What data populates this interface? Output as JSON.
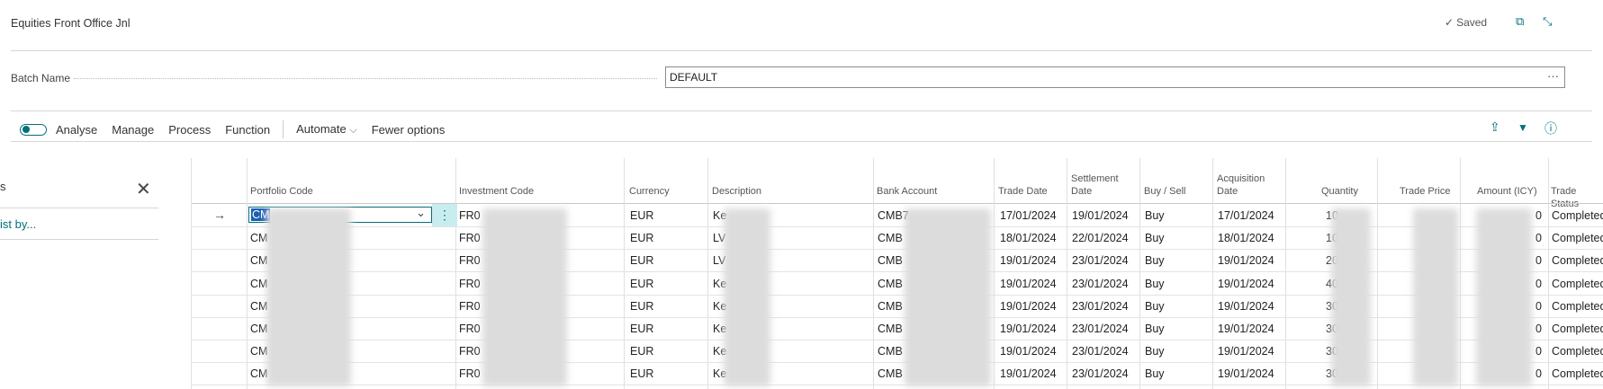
{
  "header": {
    "title": "Equities Front Office Jnl",
    "saved_label": "Saved",
    "saved_check": "✓",
    "open_new_window_icon": "⧉",
    "collapse_icon": "⤡"
  },
  "batch": {
    "label": "Batch Name",
    "value": "DEFAULT",
    "lookup_glyph": "···"
  },
  "toolbar": {
    "items": [
      "Analyse",
      "Manage",
      "Process",
      "Function"
    ],
    "automate": "Automate",
    "automate_chevron": "⌵",
    "fewer_options": "Fewer options",
    "share_icon": "⇪",
    "filter_icon": "▼",
    "info_icon": "ⓘ"
  },
  "factbox": {
    "fragment_top": "s",
    "close_icon": "✕",
    "link": "ist by..."
  },
  "columns": {
    "portfolio_code": "Portfolio Code",
    "investment_code": "Investment Code",
    "currency": "Currency",
    "description": "Description",
    "bank_account": "Bank Account",
    "trade_date": "Trade Date",
    "settlement_date_l1": "Settlement",
    "settlement_date_l2": "Date",
    "buy_sell": "Buy / Sell",
    "acquisition_date_l1": "Acquisition",
    "acquisition_date_l2": "Date",
    "quantity": "Quantity",
    "trade_price": "Trade Price",
    "amount_icy": "Amount (ICY)",
    "trade_status": "Trade Status"
  },
  "rows": [
    {
      "portfolio": "CM",
      "investment": "FR0",
      "currency": "EUR",
      "description": "Ke",
      "bank": "CMB7",
      "trade_date": "17/01/2024",
      "settlement": "19/01/2024",
      "buy_sell": "Buy",
      "acquisition": "17/01/2024",
      "quantity": "10",
      "amount_tail": "0",
      "status": "Completed"
    },
    {
      "portfolio": "CM",
      "investment": "FR0",
      "currency": "EUR",
      "description": "LV",
      "bank": "CMB",
      "trade_date": "18/01/2024",
      "settlement": "22/01/2024",
      "buy_sell": "Buy",
      "acquisition": "18/01/2024",
      "quantity": "10",
      "amount_tail": "0",
      "status": "Completed"
    },
    {
      "portfolio": "CM",
      "investment": "FR0",
      "currency": "EUR",
      "description": "LV",
      "bank": "CMB",
      "trade_date": "19/01/2024",
      "settlement": "23/01/2024",
      "buy_sell": "Buy",
      "acquisition": "19/01/2024",
      "quantity": "20",
      "amount_tail": "0",
      "status": "Completed"
    },
    {
      "portfolio": "CM",
      "investment": "FR0",
      "currency": "EUR",
      "description": "Ke",
      "bank": "CMB",
      "trade_date": "19/01/2024",
      "settlement": "23/01/2024",
      "buy_sell": "Buy",
      "acquisition": "19/01/2024",
      "quantity": "40",
      "amount_tail": "0",
      "status": "Completed"
    },
    {
      "portfolio": "CM",
      "investment": "FR0",
      "currency": "EUR",
      "description": "Ke",
      "bank": "CMB",
      "trade_date": "19/01/2024",
      "settlement": "23/01/2024",
      "buy_sell": "Buy",
      "acquisition": "19/01/2024",
      "quantity": "30",
      "amount_tail": "0",
      "status": "Completed"
    },
    {
      "portfolio": "CM",
      "investment": "FR0",
      "currency": "EUR",
      "description": "Ke",
      "bank": "CMB",
      "trade_date": "19/01/2024",
      "settlement": "23/01/2024",
      "buy_sell": "Buy",
      "acquisition": "19/01/2024",
      "quantity": "30",
      "amount_tail": "0",
      "status": "Completed"
    },
    {
      "portfolio": "CM",
      "investment": "FR0",
      "currency": "EUR",
      "description": "Ke",
      "bank": "CMB",
      "trade_date": "19/01/2024",
      "settlement": "23/01/2024",
      "buy_sell": "Buy",
      "acquisition": "19/01/2024",
      "quantity": "30",
      "amount_tail": "0",
      "status": "Completed"
    },
    {
      "portfolio": "CM",
      "investment": "FR0",
      "currency": "EUR",
      "description": "Ke",
      "bank": "CMB",
      "trade_date": "19/01/2024",
      "settlement": "23/01/2024",
      "buy_sell": "Buy",
      "acquisition": "19/01/2024",
      "quantity": "30",
      "amount_tail": "0",
      "status": "Completed"
    }
  ],
  "selected_row": {
    "arrow": "→",
    "portfolio_prefix": "CM",
    "dropdown_icon": "⌄",
    "row_menu": "⋮"
  },
  "colors": {
    "accent": "#00707a",
    "row_menu_bg": "#c9ecef"
  }
}
